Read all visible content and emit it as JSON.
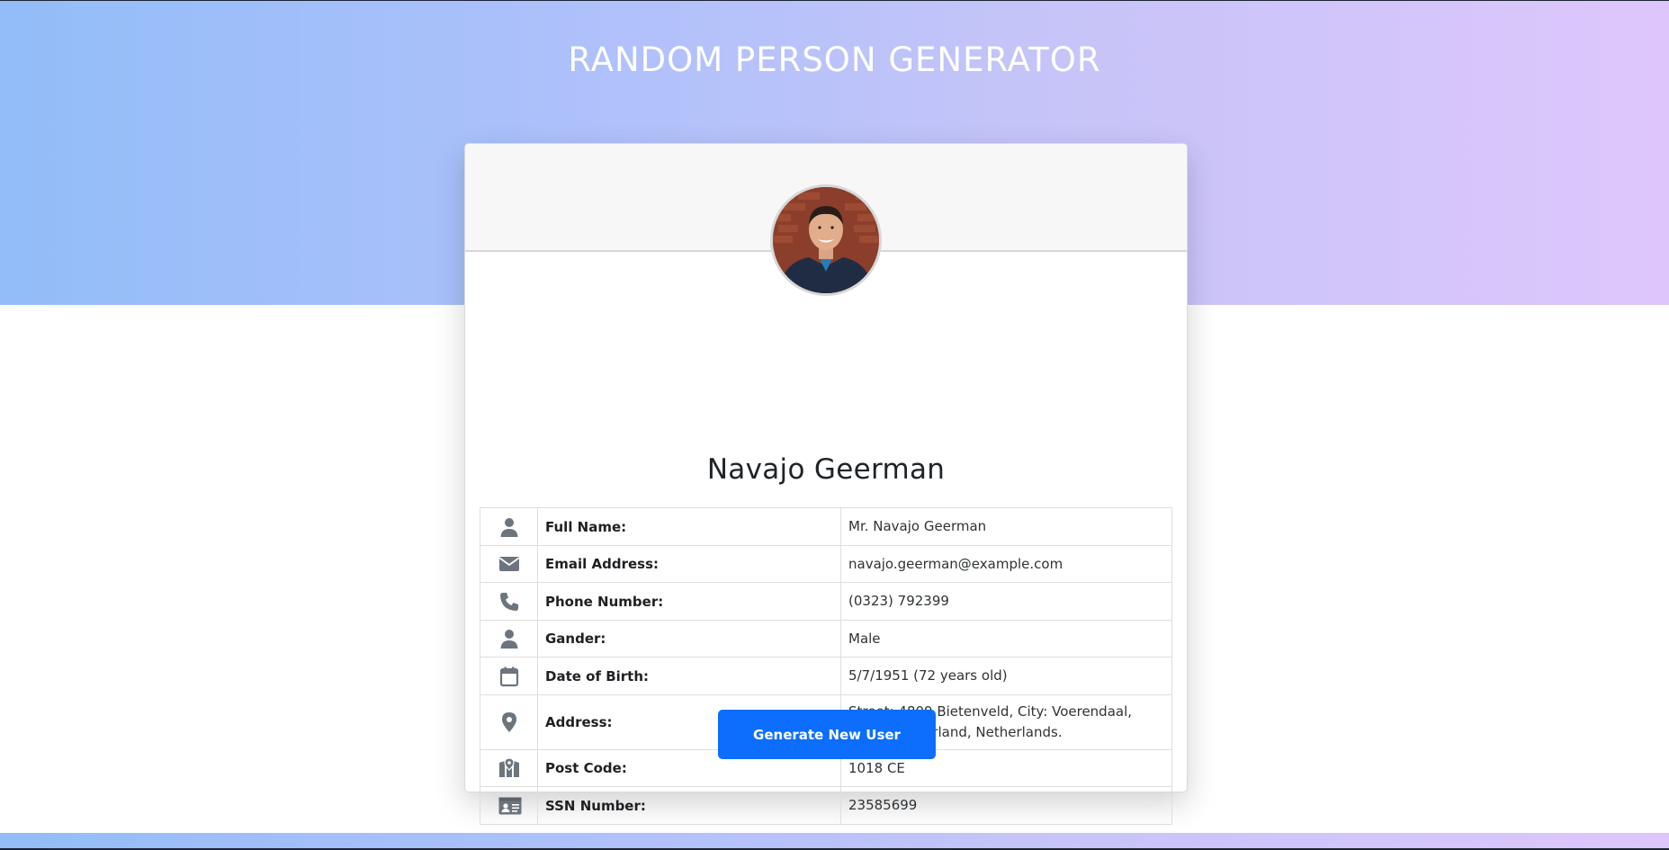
{
  "app": {
    "title": "RANDOM PERSON GENERATOR"
  },
  "colors": {
    "gradient_start": "#92bdf8",
    "gradient_end": "#dec6fc",
    "primary_button": "#0d6efd",
    "icon_color": "#6c757d"
  },
  "person": {
    "display_name": "Navajo Geerman",
    "avatar_icon": "user-photo"
  },
  "details": [
    {
      "icon": "user-icon",
      "label": "Full Name:",
      "value": "Mr. Navajo Geerman"
    },
    {
      "icon": "envelope-icon",
      "label": "Email Address:",
      "value": "navajo.geerman@example.com"
    },
    {
      "icon": "phone-icon",
      "label": "Phone Number:",
      "value": "(0323) 792399"
    },
    {
      "icon": "user-icon",
      "label": "Gander:",
      "value": "Male"
    },
    {
      "icon": "calendar-icon",
      "label": "Date of Birth:",
      "value": "5/7/1951 (72 years old)"
    },
    {
      "icon": "map-pin-icon",
      "label": "Address:",
      "value": "Street: 4809 Bietenveld, City: Voerendaal, State: Gelderland, Netherlands."
    },
    {
      "icon": "map-icon",
      "label": "Post Code:",
      "value": "1018 CE"
    },
    {
      "icon": "id-card-icon",
      "label": "SSN Number:",
      "value": "23585699"
    }
  ],
  "actions": {
    "generate_label": "Generate New User"
  }
}
